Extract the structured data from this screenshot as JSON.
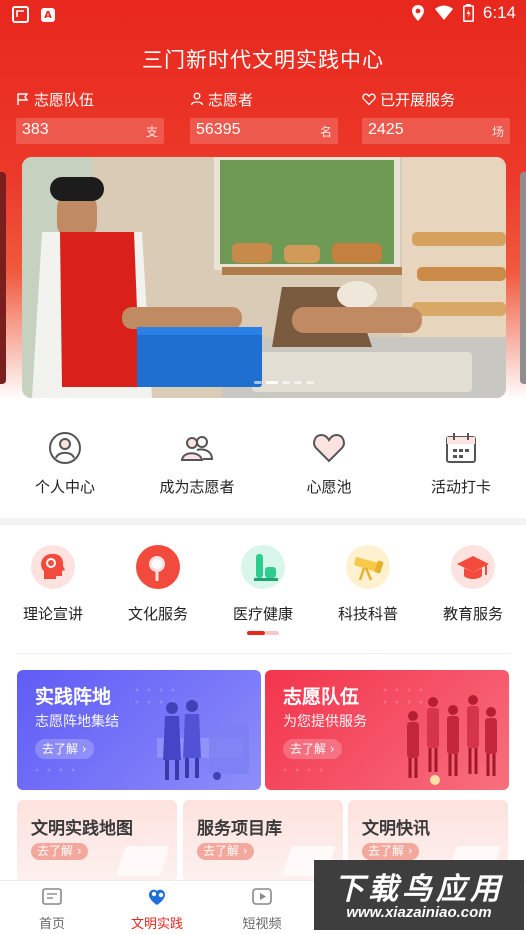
{
  "status_bar": {
    "time": "6:14",
    "left_icons": [
      "notification-icon",
      "app-a-icon"
    ],
    "right_icons": [
      "location-icon",
      "wifi-icon",
      "battery-icon"
    ],
    "app_badge_letter": "A"
  },
  "header": {
    "title": "三门新时代文明实践中心"
  },
  "stats": [
    {
      "icon": "flag-icon",
      "label": "志愿队伍",
      "value": "383",
      "unit": "支"
    },
    {
      "icon": "person-icon",
      "label": "志愿者",
      "value": "56395",
      "unit": "名"
    },
    {
      "icon": "heart-icon",
      "label": "已开展服务",
      "value": "2425",
      "unit": "场"
    }
  ],
  "banner": {
    "slide_count": 5,
    "active_slide": 2
  },
  "quick_nav": [
    {
      "icon": "personal-center-icon",
      "label": "个人中心"
    },
    {
      "icon": "volunteers-icon",
      "label": "成为志愿者"
    },
    {
      "icon": "heart-outline-icon",
      "label": "心愿池"
    },
    {
      "icon": "calendar-icon",
      "label": "活动打卡"
    }
  ],
  "categories": [
    {
      "icon": "head-brain-icon",
      "label": "理论宣讲",
      "color": "#f24a3d"
    },
    {
      "icon": "magnifier-icon",
      "label": "文化服务",
      "color": "#f24a3d"
    },
    {
      "icon": "flask-icon",
      "label": "医疗健康",
      "color": "#2ecc8f"
    },
    {
      "icon": "telescope-icon",
      "label": "科技科普",
      "color": "#f7c948"
    },
    {
      "icon": "graduation-cap-icon",
      "label": "教育服务",
      "color": "#f24a3d"
    }
  ],
  "feature_cards": [
    {
      "title": "实践阵地",
      "subtitle": "志愿阵地集结",
      "button": "去了解 ›",
      "color": "#5f5cf6"
    },
    {
      "title": "志愿队伍",
      "subtitle": "为您提供服务",
      "button": "去了解 ›",
      "color": "#f2354c"
    }
  ],
  "small_cards": [
    {
      "title": "文明实践地图",
      "button": "去了解 ›"
    },
    {
      "title": "服务项目库",
      "button": "去了解 ›"
    },
    {
      "title": "文明快讯",
      "button": "去了解 ›"
    }
  ],
  "tabbar": [
    {
      "icon": "home-icon",
      "label": "首页",
      "active": false
    },
    {
      "icon": "practice-icon",
      "label": "文明实践",
      "active": true
    },
    {
      "icon": "video-icon",
      "label": "短视频",
      "active": false
    }
  ],
  "watermark": {
    "line1": "下载鸟应用",
    "line2": "www.xiazainiao.com"
  },
  "colors": {
    "brand_red": "#e8271d",
    "tab_active": "#e8271d"
  }
}
